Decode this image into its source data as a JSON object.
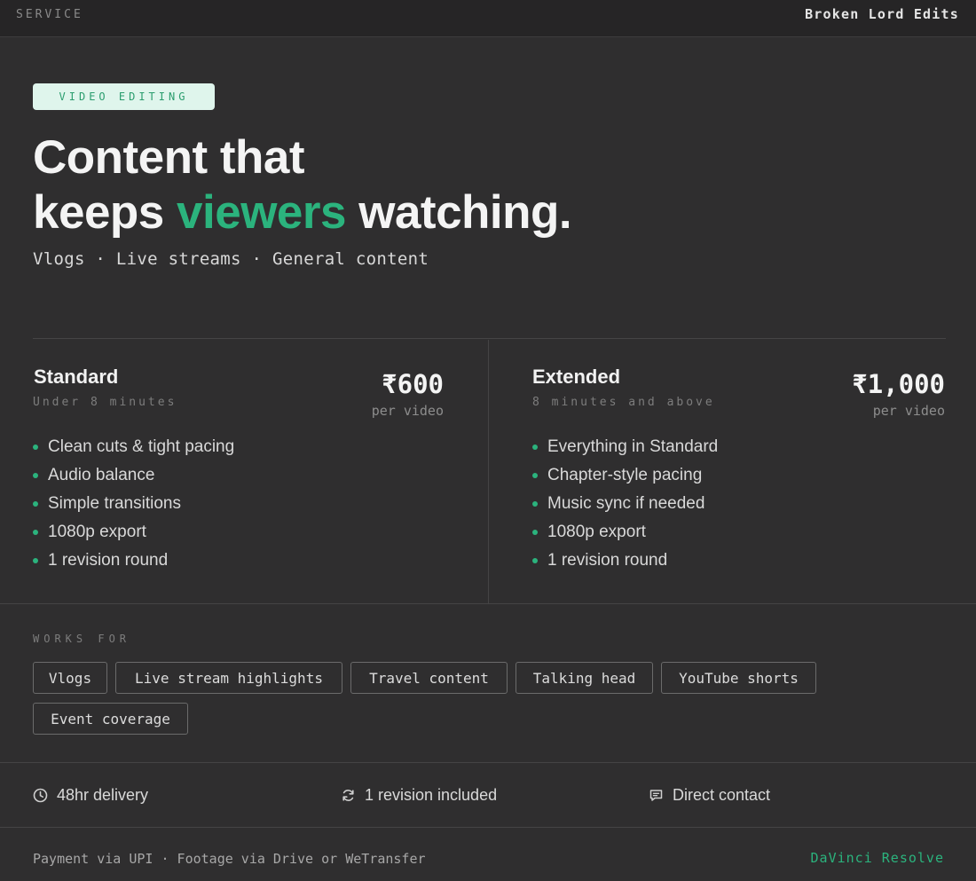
{
  "topbar": {
    "section": "SERVICE",
    "brand": "Broken Lord Edits"
  },
  "hero": {
    "badge": "VIDEO EDITING",
    "headline_line1": "Content that",
    "headline_line2_pre": "keeps ",
    "headline_accent": "viewers",
    "headline_line2_post": " watching.",
    "subline": "Vlogs · Live streams · General content"
  },
  "plans": [
    {
      "name": "Standard",
      "note": "Under 8 minutes",
      "price": "₹600",
      "per": "per video",
      "features": [
        "Clean cuts & tight pacing",
        "Audio balance",
        "Simple transitions",
        "1080p export",
        "1 revision round"
      ]
    },
    {
      "name": "Extended",
      "note": "8 minutes and above",
      "price": "₹1,000",
      "per": "per video",
      "features": [
        "Everything in Standard",
        "Chapter-style pacing",
        "Music sync if needed",
        "1080p export",
        "1 revision round"
      ]
    }
  ],
  "works_for": {
    "label": "WORKS FOR",
    "tags": [
      "Vlogs",
      "Live stream highlights",
      "Travel content",
      "Talking head",
      "YouTube shorts",
      "Event coverage"
    ]
  },
  "perks": [
    {
      "icon": "clock-icon",
      "label": "48hr delivery"
    },
    {
      "icon": "refresh-icon",
      "label": "1 revision included"
    },
    {
      "icon": "message-icon",
      "label": "Direct contact"
    }
  ],
  "footer": {
    "left": "Payment via UPI · Footage via Drive or WeTransfer",
    "right": "DaVinci Resolve"
  },
  "colors": {
    "accent": "#2bb37d",
    "background": "#2f2e2f",
    "topbar": "#262526",
    "badge_bg": "#dff5ec"
  }
}
